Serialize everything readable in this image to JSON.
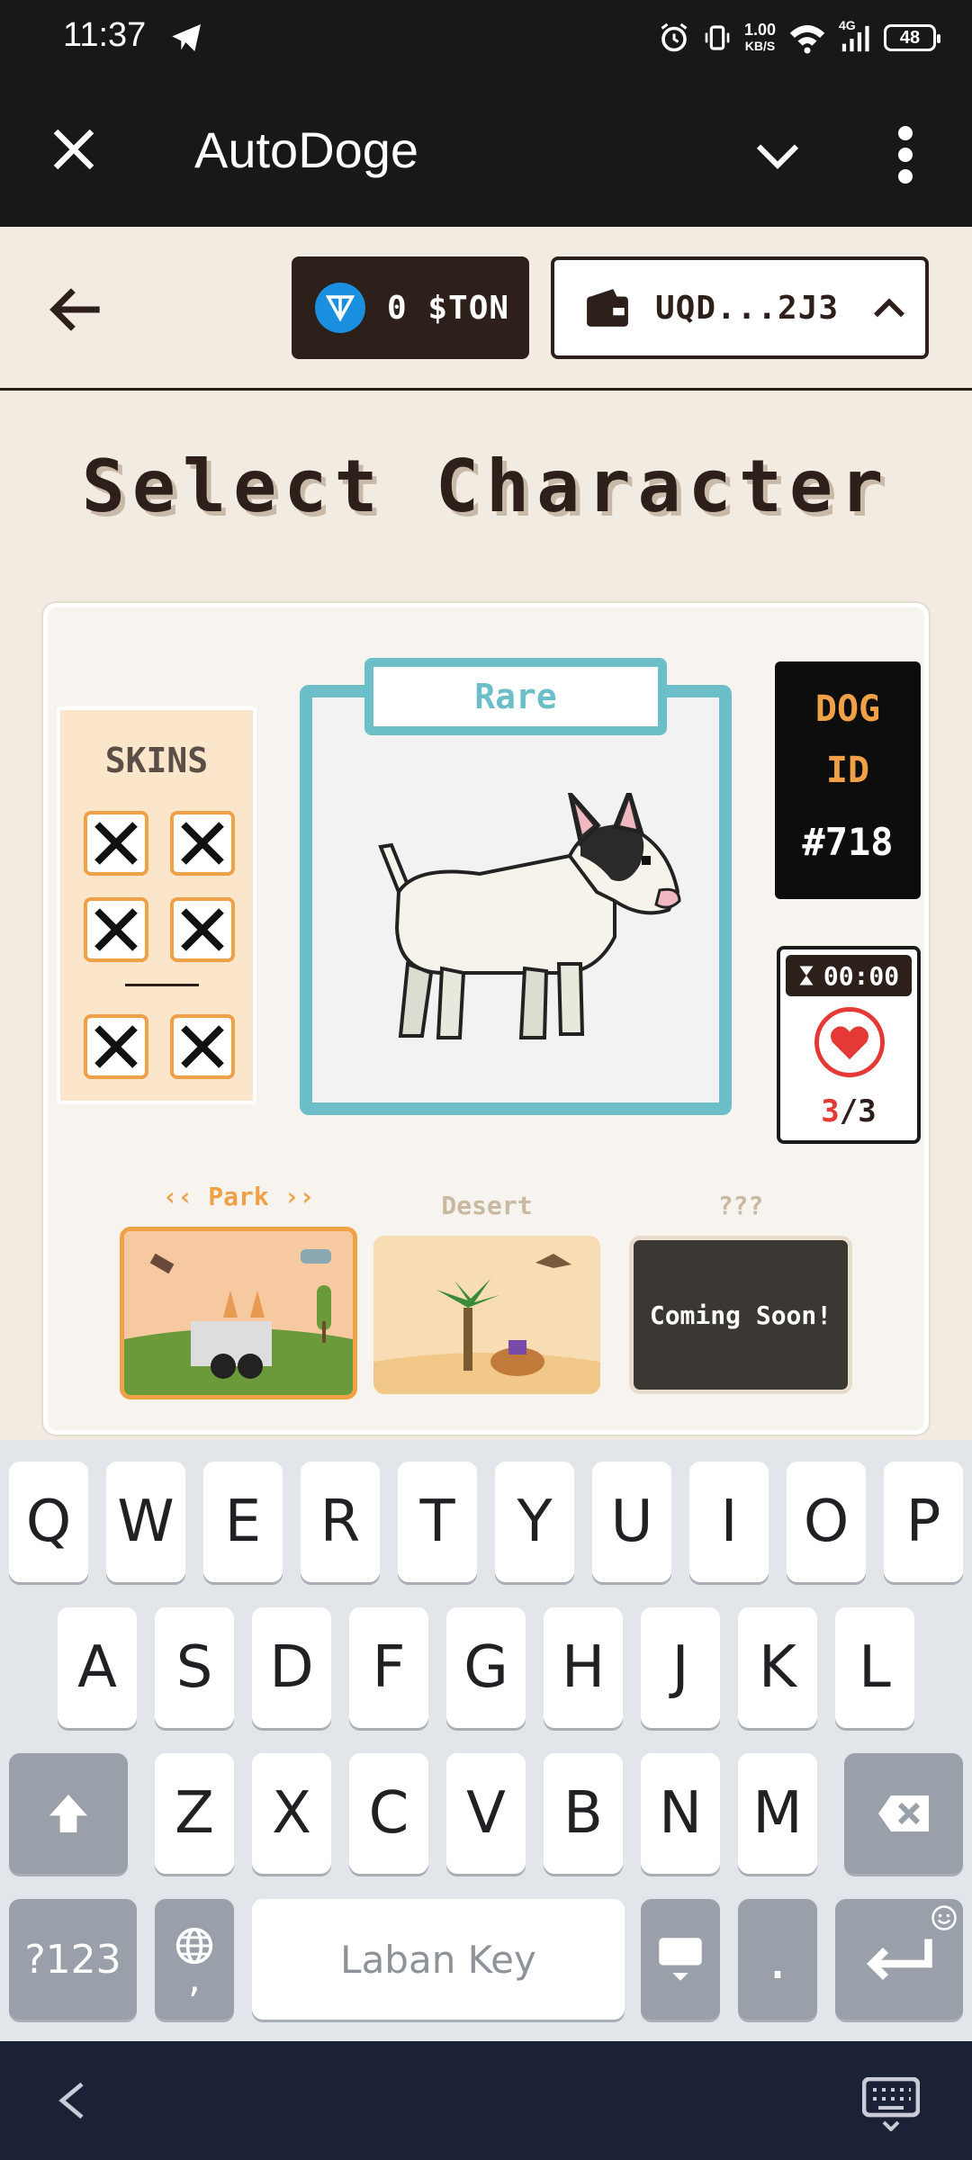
{
  "status_bar": {
    "time": "11:37",
    "speed_value": "1.00",
    "speed_unit": "KB/S",
    "network": "4G",
    "battery": "48",
    "icons": [
      "telegram-send-icon",
      "alarm-icon",
      "vibrate-icon",
      "wifi-icon",
      "signal-icon",
      "battery-icon"
    ]
  },
  "app_bar": {
    "title": "AutoDoge",
    "icons": [
      "close-icon",
      "chevron-down-icon",
      "more-vert-icon"
    ]
  },
  "topnav": {
    "ton_balance": "0 $TON",
    "wallet_address": "UQD...2J3"
  },
  "page": {
    "title": "Select Character"
  },
  "skins": {
    "title": "SKINS",
    "slots": [
      "empty",
      "empty",
      "empty",
      "empty",
      "empty",
      "empty"
    ]
  },
  "character": {
    "rarity": "Rare",
    "dog_id_line1": "DOG",
    "dog_id_line2": "ID",
    "dog_id_number": "#718",
    "timer": "00:00",
    "lives_current": "3",
    "lives_sep": "/",
    "lives_max": "3"
  },
  "maps": [
    {
      "label": "‹‹ Park ››",
      "selected": true
    },
    {
      "label": "Desert",
      "selected": false
    },
    {
      "label": "???",
      "selected": false,
      "overlay": "Coming Soon!"
    }
  ],
  "keyboard": {
    "row1": [
      "Q",
      "W",
      "E",
      "R",
      "T",
      "Y",
      "U",
      "I",
      "O",
      "P"
    ],
    "row2": [
      "A",
      "S",
      "D",
      "F",
      "G",
      "H",
      "J",
      "K",
      "L"
    ],
    "row3": [
      "Z",
      "X",
      "C",
      "V",
      "B",
      "N",
      "M"
    ],
    "symbols_key": "?123",
    "comma_key": ",",
    "space_label": "Laban Key",
    "period_key": "."
  },
  "colors": {
    "rare_accent": "#6cbfc9",
    "orange_accent": "#f0a046",
    "dark_brown": "#2d1f1a",
    "heart_red": "#e53935"
  }
}
